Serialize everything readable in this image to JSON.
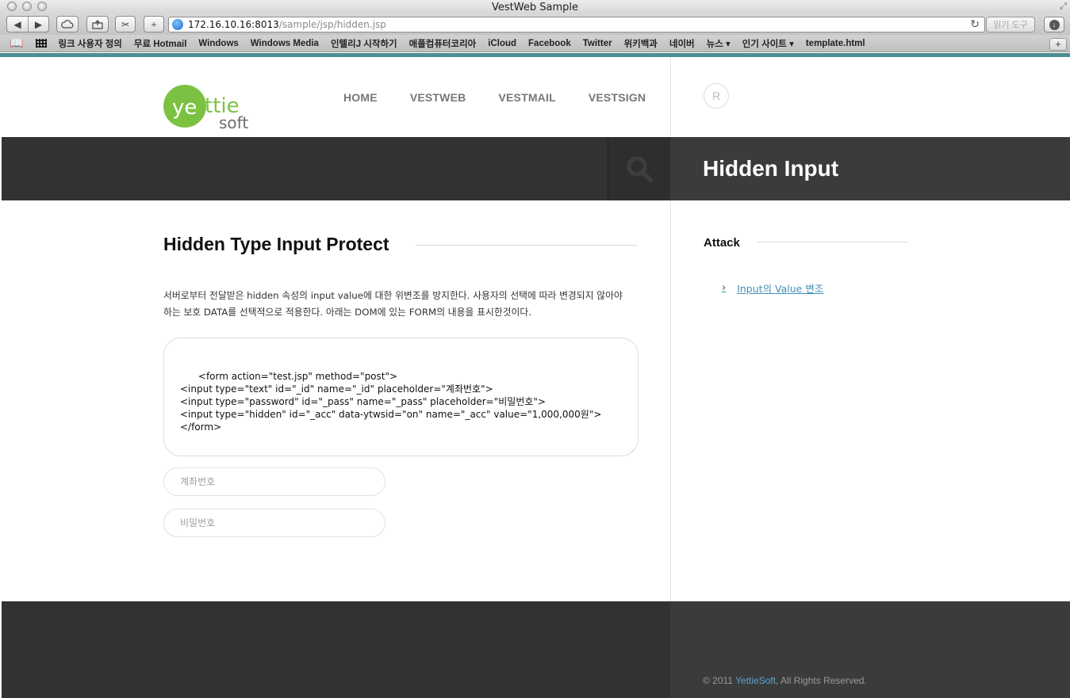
{
  "window": {
    "title": "VestWeb Sample"
  },
  "toolbar": {
    "url_host": "172.16.10.16:8013",
    "url_path": "/sample/jsp/hidden.jsp",
    "reader_label": "읽기 도구"
  },
  "bookmarks": [
    "링크 사용자 정의",
    "무료 Hotmail",
    "Windows",
    "Windows Media",
    "인텔리J 시작하기",
    "애플컴퓨터코리아",
    "iCloud",
    "Facebook",
    "Twitter",
    "위키백과",
    "네이버",
    "뉴스 ▾",
    "인기 사이트 ▾",
    "template.html"
  ],
  "header": {
    "nav": [
      "HOME",
      "VESTWEB",
      "VESTMAIL",
      "VESTSIGN"
    ],
    "badge": "R"
  },
  "hero": {
    "title": "Hidden Input"
  },
  "main": {
    "section_title": "Hidden Type Input Protect",
    "description_line1": "서버로부터 전달받은 hidden 속성의 input value에 대한 위변조를 방지한다. 사용자의 선택에 따라 변경되지 않아야",
    "description_line2": "하는 보호 DATA를 선택적으로 적용한다. 아래는 DOM에 있는 FORM의 내용을 표시한것이다.",
    "code": "<form action=\"test.jsp\" method=\"post\">\n<input type=\"text\" id=\"_id\" name=\"_id\" placeholder=\"계좌번호\">\n<input type=\"password\" id=\"_pass\" name=\"_pass\" placeholder=\"비밀번호\">\n<input type=\"hidden\" id=\"_acc\" data-ytwsid=\"on\" name=\"_acc\" value=\"1,000,000원\">\n</form>",
    "account_placeholder": "계좌번호",
    "password_placeholder": "비밀번호"
  },
  "sidebar": {
    "title": "Attack",
    "link": "Input의 Value 변조"
  },
  "footer": {
    "copyright_prefix": "© 2011 ",
    "brand": "YettieSoft",
    "copyright_suffix": ", All Rights Reserved."
  },
  "colors": {
    "dark_band": "#323232",
    "accent_link": "#3f8fb5",
    "logo_green": "#7cc242"
  }
}
